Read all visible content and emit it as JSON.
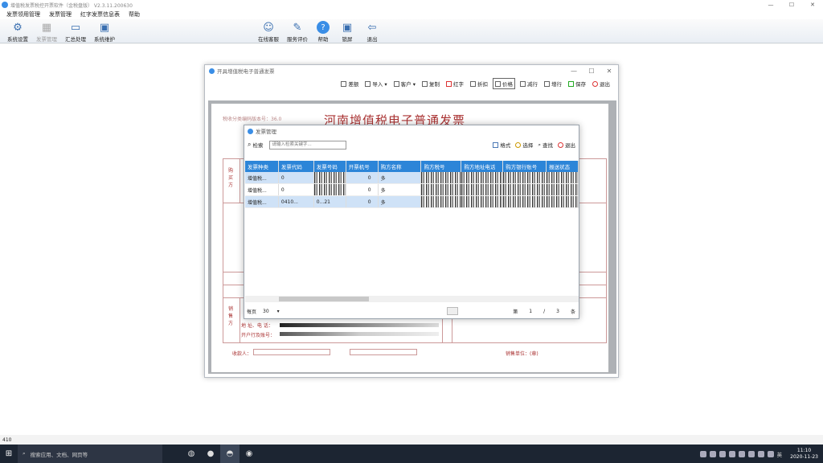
{
  "app": {
    "title": "增值税发票税控开票软件（金税盘版） V2.3.11.200630",
    "wc": [
      "—",
      "☐",
      "✕"
    ]
  },
  "menu": [
    "发票领用管理",
    "发票管理",
    "红字发票信息表",
    "帮助"
  ],
  "toolbar": {
    "left": [
      {
        "label": "系统设置",
        "icon": "gear-icon",
        "glyph": "⚙"
      },
      {
        "label": "发票管理",
        "icon": "invoice-icon",
        "glyph": "▦"
      },
      {
        "label": "汇总处理",
        "icon": "monitor-icon",
        "glyph": "▭"
      },
      {
        "label": "系统维护",
        "icon": "maintenance-icon",
        "glyph": "▣"
      }
    ],
    "right": [
      {
        "label": "在线客服",
        "icon": "agent-icon",
        "glyph": "☺"
      },
      {
        "label": "服务评价",
        "icon": "review-icon",
        "glyph": "✎"
      },
      {
        "label": "帮助",
        "icon": "help-icon",
        "glyph": "?"
      },
      {
        "label": "锁屏",
        "icon": "lock-screen-icon",
        "glyph": "▣"
      },
      {
        "label": "退出",
        "icon": "exit-arrow-icon",
        "glyph": "⇦"
      }
    ]
  },
  "invoice_window": {
    "title": "开具增值税电子普通发票",
    "wc": [
      "—",
      "☐",
      "✕"
    ],
    "toolbar": [
      "差额",
      "导入 ▾",
      "客户 ▾",
      "复制",
      "红字",
      "折扣",
      "价格",
      "减行",
      "增行",
      "保存",
      "退出"
    ],
    "code_label": "税收分类编码版本号：36.0",
    "heading": "河南增值税电子普通发票",
    "buyer_side": "购买方",
    "seller_side": "销售方",
    "addr_label": "地 址、电 话：",
    "bank_label": "开户行及账号：",
    "payee_label": "收款人：",
    "seal_label": "销售单位：(章)",
    "remark_label": "注"
  },
  "dialog": {
    "title": "发票管理",
    "search_label": "检索",
    "search_placeholder": "请输入检索关键字...",
    "actions": [
      "格式",
      "选择",
      "查找",
      "退出"
    ],
    "columns": [
      "发票种类",
      "发票代码",
      "发票号码",
      "开票机号",
      "购方名称",
      "购方税号",
      "购方地址电话",
      "购方银行账号",
      "报送状态"
    ],
    "rows": [
      [
        "增值税...",
        "0",
        "",
        "0",
        "多",
        "",
        "",
        "",
        ""
      ],
      [
        "增值税...",
        "0",
        "",
        "0",
        "多",
        "",
        "",
        "",
        ""
      ],
      [
        "增值税...",
        "0410...",
        "0...21",
        "0",
        "多",
        "",
        "",
        "",
        ""
      ]
    ],
    "pager": {
      "per_page_label": "每页",
      "per_page": "30",
      "page_label": "第",
      "page": "1",
      "slash": "/",
      "total": "3",
      "unit": "条"
    }
  },
  "status_bar": "410",
  "taskbar": {
    "search": "搜索应用、文档、网页等",
    "time": "11:10",
    "date": "2020-11-23",
    "ime": "英"
  }
}
